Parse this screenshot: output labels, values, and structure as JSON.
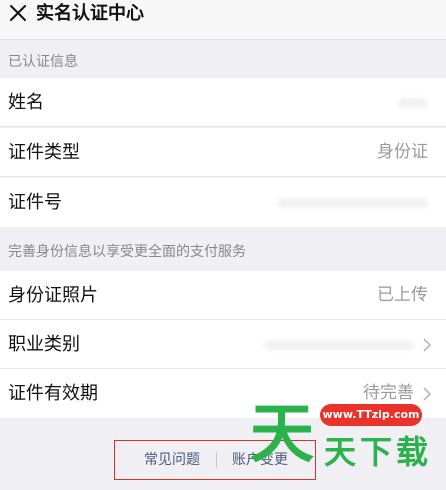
{
  "header": {
    "title": "实名认证中心"
  },
  "section_verified": {
    "title": "已认证信息",
    "rows": [
      {
        "label": "姓名",
        "value": ""
      },
      {
        "label": "证件类型",
        "value": "身份证"
      },
      {
        "label": "证件号",
        "value": ""
      }
    ]
  },
  "section_improve": {
    "title": "完善身份信息以享受更全面的支付服务",
    "rows": [
      {
        "label": "身份证照片",
        "value": "已上传"
      },
      {
        "label": "职业类别",
        "value": ""
      },
      {
        "label": "证件有效期",
        "value": "待完善"
      }
    ]
  },
  "footer": {
    "faq": "常见问题",
    "account_change": "账户变更"
  },
  "watermark": {
    "url": "www.TTzip.com",
    "big_char": "天",
    "text": "天下载"
  },
  "colors": {
    "highlight_box": "#d9342b",
    "watermark_green": "#2bb24c",
    "watermark_red": "#e8322a"
  }
}
